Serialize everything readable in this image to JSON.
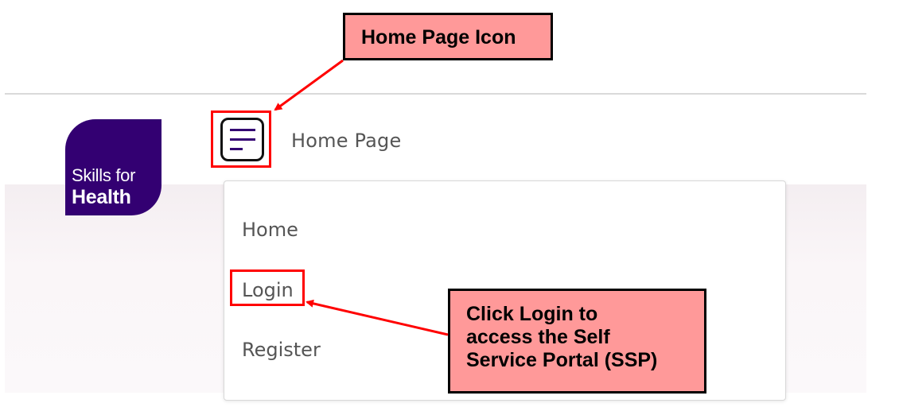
{
  "logo": {
    "line1": "Skills for",
    "line2": "Health",
    "color": "#330072"
  },
  "header": {
    "menu_icon": "hamburger-menu-icon",
    "page_label": "Home Page"
  },
  "dropdown": {
    "items": [
      {
        "label": "Home"
      },
      {
        "label": "Login"
      },
      {
        "label": "Register"
      }
    ]
  },
  "annotations": {
    "top_callout": "Home Page Icon",
    "bottom_callout_lines": [
      "Click Login to",
      "access the Self",
      "Service Portal (SSP)"
    ],
    "highlight_color": "#ff0000",
    "callout_fill": "#ff9999"
  }
}
